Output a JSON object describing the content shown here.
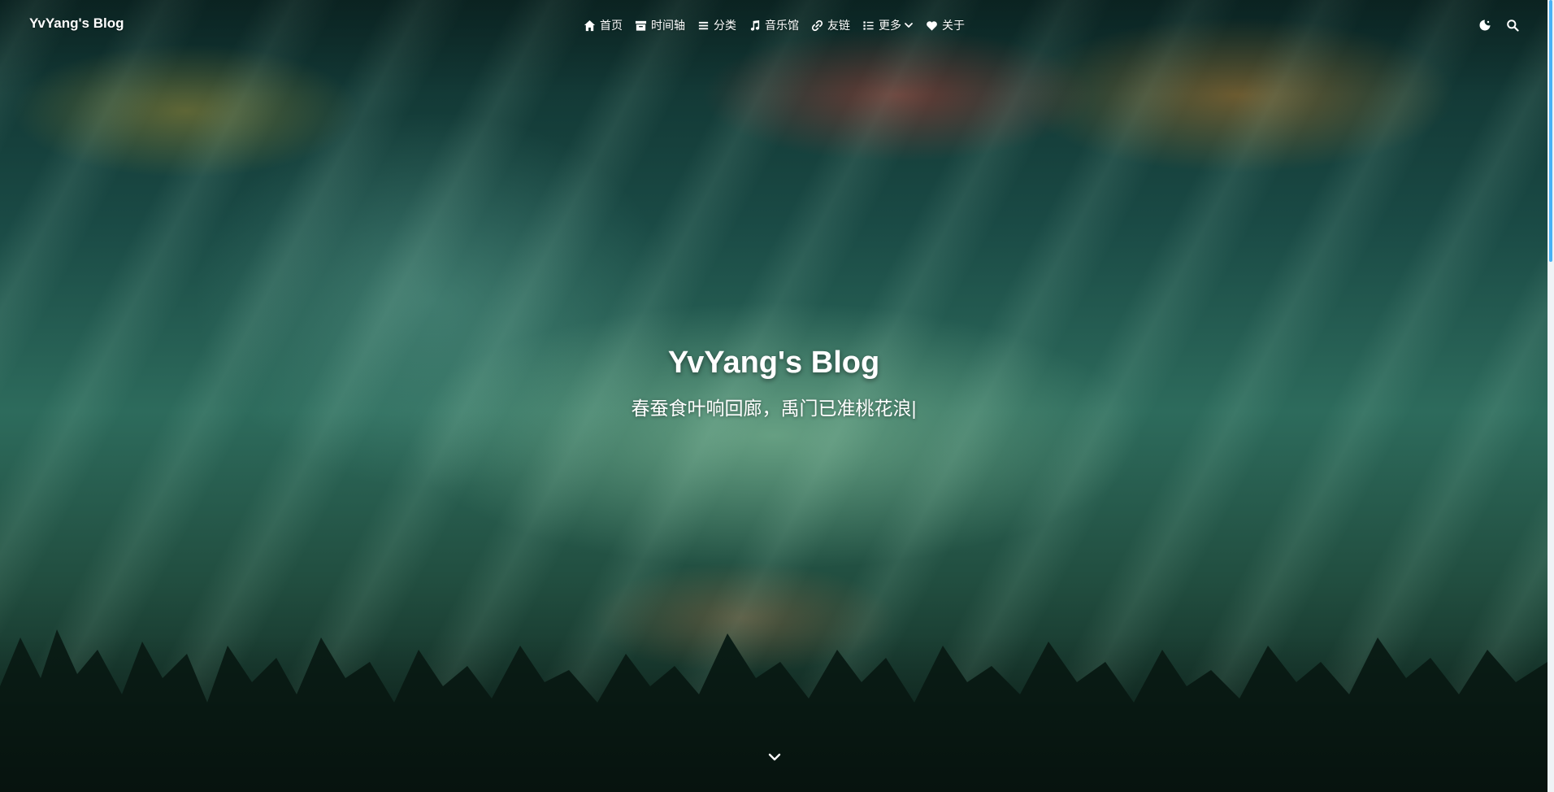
{
  "nav": {
    "brand": "YvYang's Blog",
    "items": [
      {
        "label": "首页",
        "icon": "home-icon"
      },
      {
        "label": "时间轴",
        "icon": "archive-icon"
      },
      {
        "label": "分类",
        "icon": "list-icon"
      },
      {
        "label": "音乐馆",
        "icon": "music-icon"
      },
      {
        "label": "友链",
        "icon": "link-icon"
      },
      {
        "label": "更多",
        "icon": "more-list-icon",
        "has_dropdown": true
      },
      {
        "label": "关于",
        "icon": "heart-icon"
      }
    ],
    "tools": [
      {
        "icon": "theme-toggle-icon"
      },
      {
        "icon": "search-icon"
      }
    ]
  },
  "hero": {
    "title": "YvYang's Blog",
    "subtitle": "春蚕食叶响回廊，禹门已准桃花浪",
    "typing_cursor": "|",
    "scroll_icon": "chevron-down-icon"
  },
  "colors": {
    "nav_text": "#ffffff",
    "scrollbar_thumb": "#49b1f5",
    "hero_tint": "#2d6b5c"
  }
}
